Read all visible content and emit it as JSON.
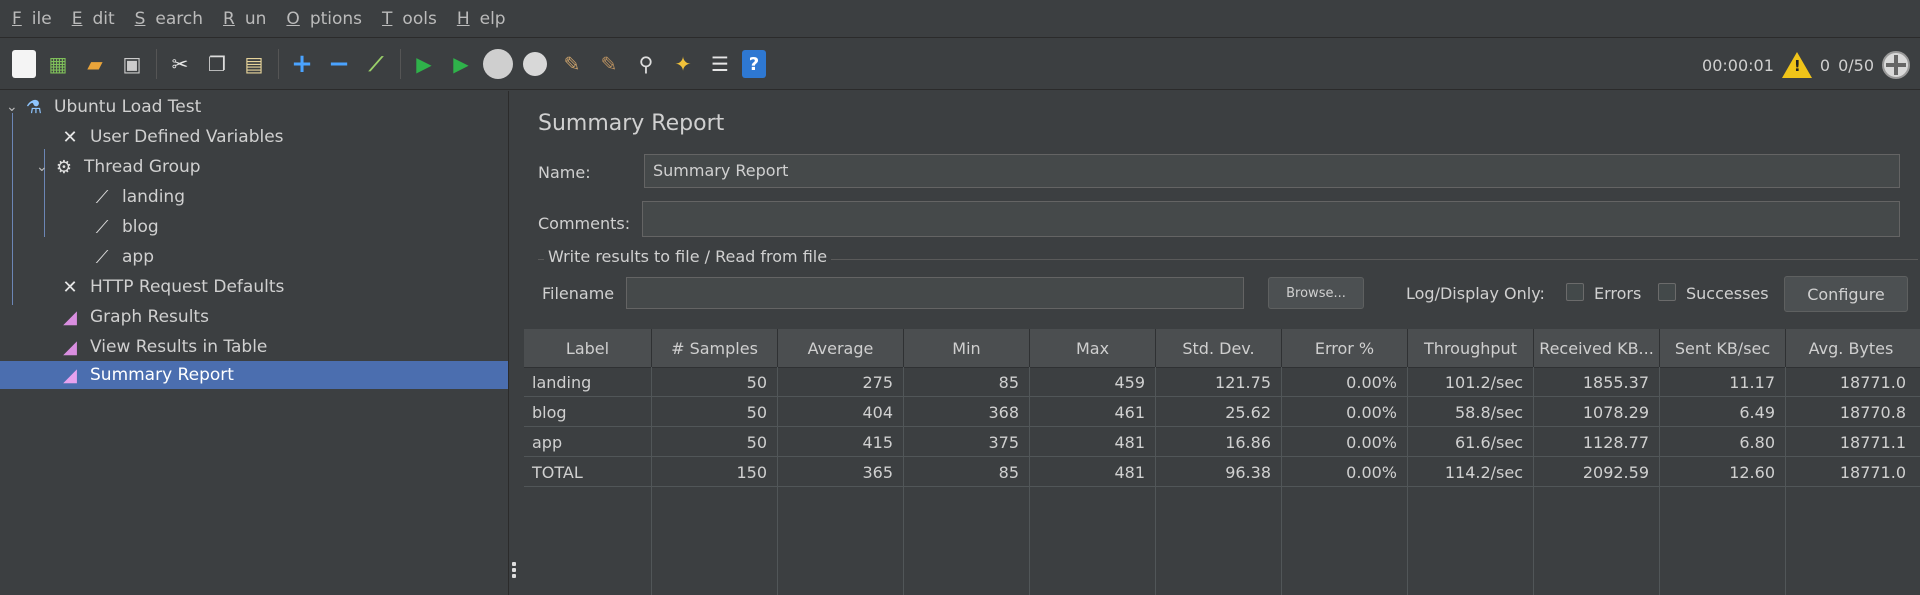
{
  "menu": [
    {
      "u": "F",
      "rest": "ile"
    },
    {
      "u": "E",
      "rest": "dit"
    },
    {
      "u": "S",
      "rest": "earch"
    },
    {
      "u": "R",
      "rest": "un"
    },
    {
      "u": "O",
      "rest": "ptions"
    },
    {
      "u": "T",
      "rest": "ools"
    },
    {
      "u": "H",
      "rest": "elp"
    }
  ],
  "toolbar": {
    "elapsed": "00:00:01",
    "warnings": "0",
    "threads": "0/50"
  },
  "tree": {
    "root": "Ubuntu Load Test",
    "udv": "User Defined Variables",
    "thread_group": "Thread Group",
    "landing": "landing",
    "blog": "blog",
    "app": "app",
    "http_defaults": "HTTP Request Defaults",
    "graph_results": "Graph Results",
    "view_results_table": "View Results in Table",
    "summary_report": "Summary Report"
  },
  "panel": {
    "title": "Summary Report",
    "name_label": "Name:",
    "name_value": "Summary Report",
    "comments_label": "Comments:",
    "comments_value": "",
    "section_label": "Write results to file / Read from file",
    "filename_label": "Filename",
    "filename_value": "",
    "browse_label": "Browse...",
    "log_display_label": "Log/Display Only:",
    "errors_label": "Errors",
    "successes_label": "Successes",
    "configure_label": "Configure"
  },
  "table": {
    "headers": [
      "Label",
      "# Samples",
      "Average",
      "Min",
      "Max",
      "Std. Dev.",
      "Error %",
      "Throughput",
      "Received KB...",
      "Sent KB/sec",
      "Avg. Bytes"
    ],
    "rows": [
      [
        "landing",
        "50",
        "275",
        "85",
        "459",
        "121.75",
        "0.00%",
        "101.2/sec",
        "1855.37",
        "11.17",
        "18771.0"
      ],
      [
        "blog",
        "50",
        "404",
        "368",
        "461",
        "25.62",
        "0.00%",
        "58.8/sec",
        "1078.29",
        "6.49",
        "18770.8"
      ],
      [
        "app",
        "50",
        "415",
        "375",
        "481",
        "16.86",
        "0.00%",
        "61.6/sec",
        "1128.77",
        "6.80",
        "18771.1"
      ],
      [
        "TOTAL",
        "150",
        "365",
        "85",
        "481",
        "96.38",
        "0.00%",
        "114.2/sec",
        "2092.59",
        "12.60",
        "18771.0"
      ]
    ]
  }
}
